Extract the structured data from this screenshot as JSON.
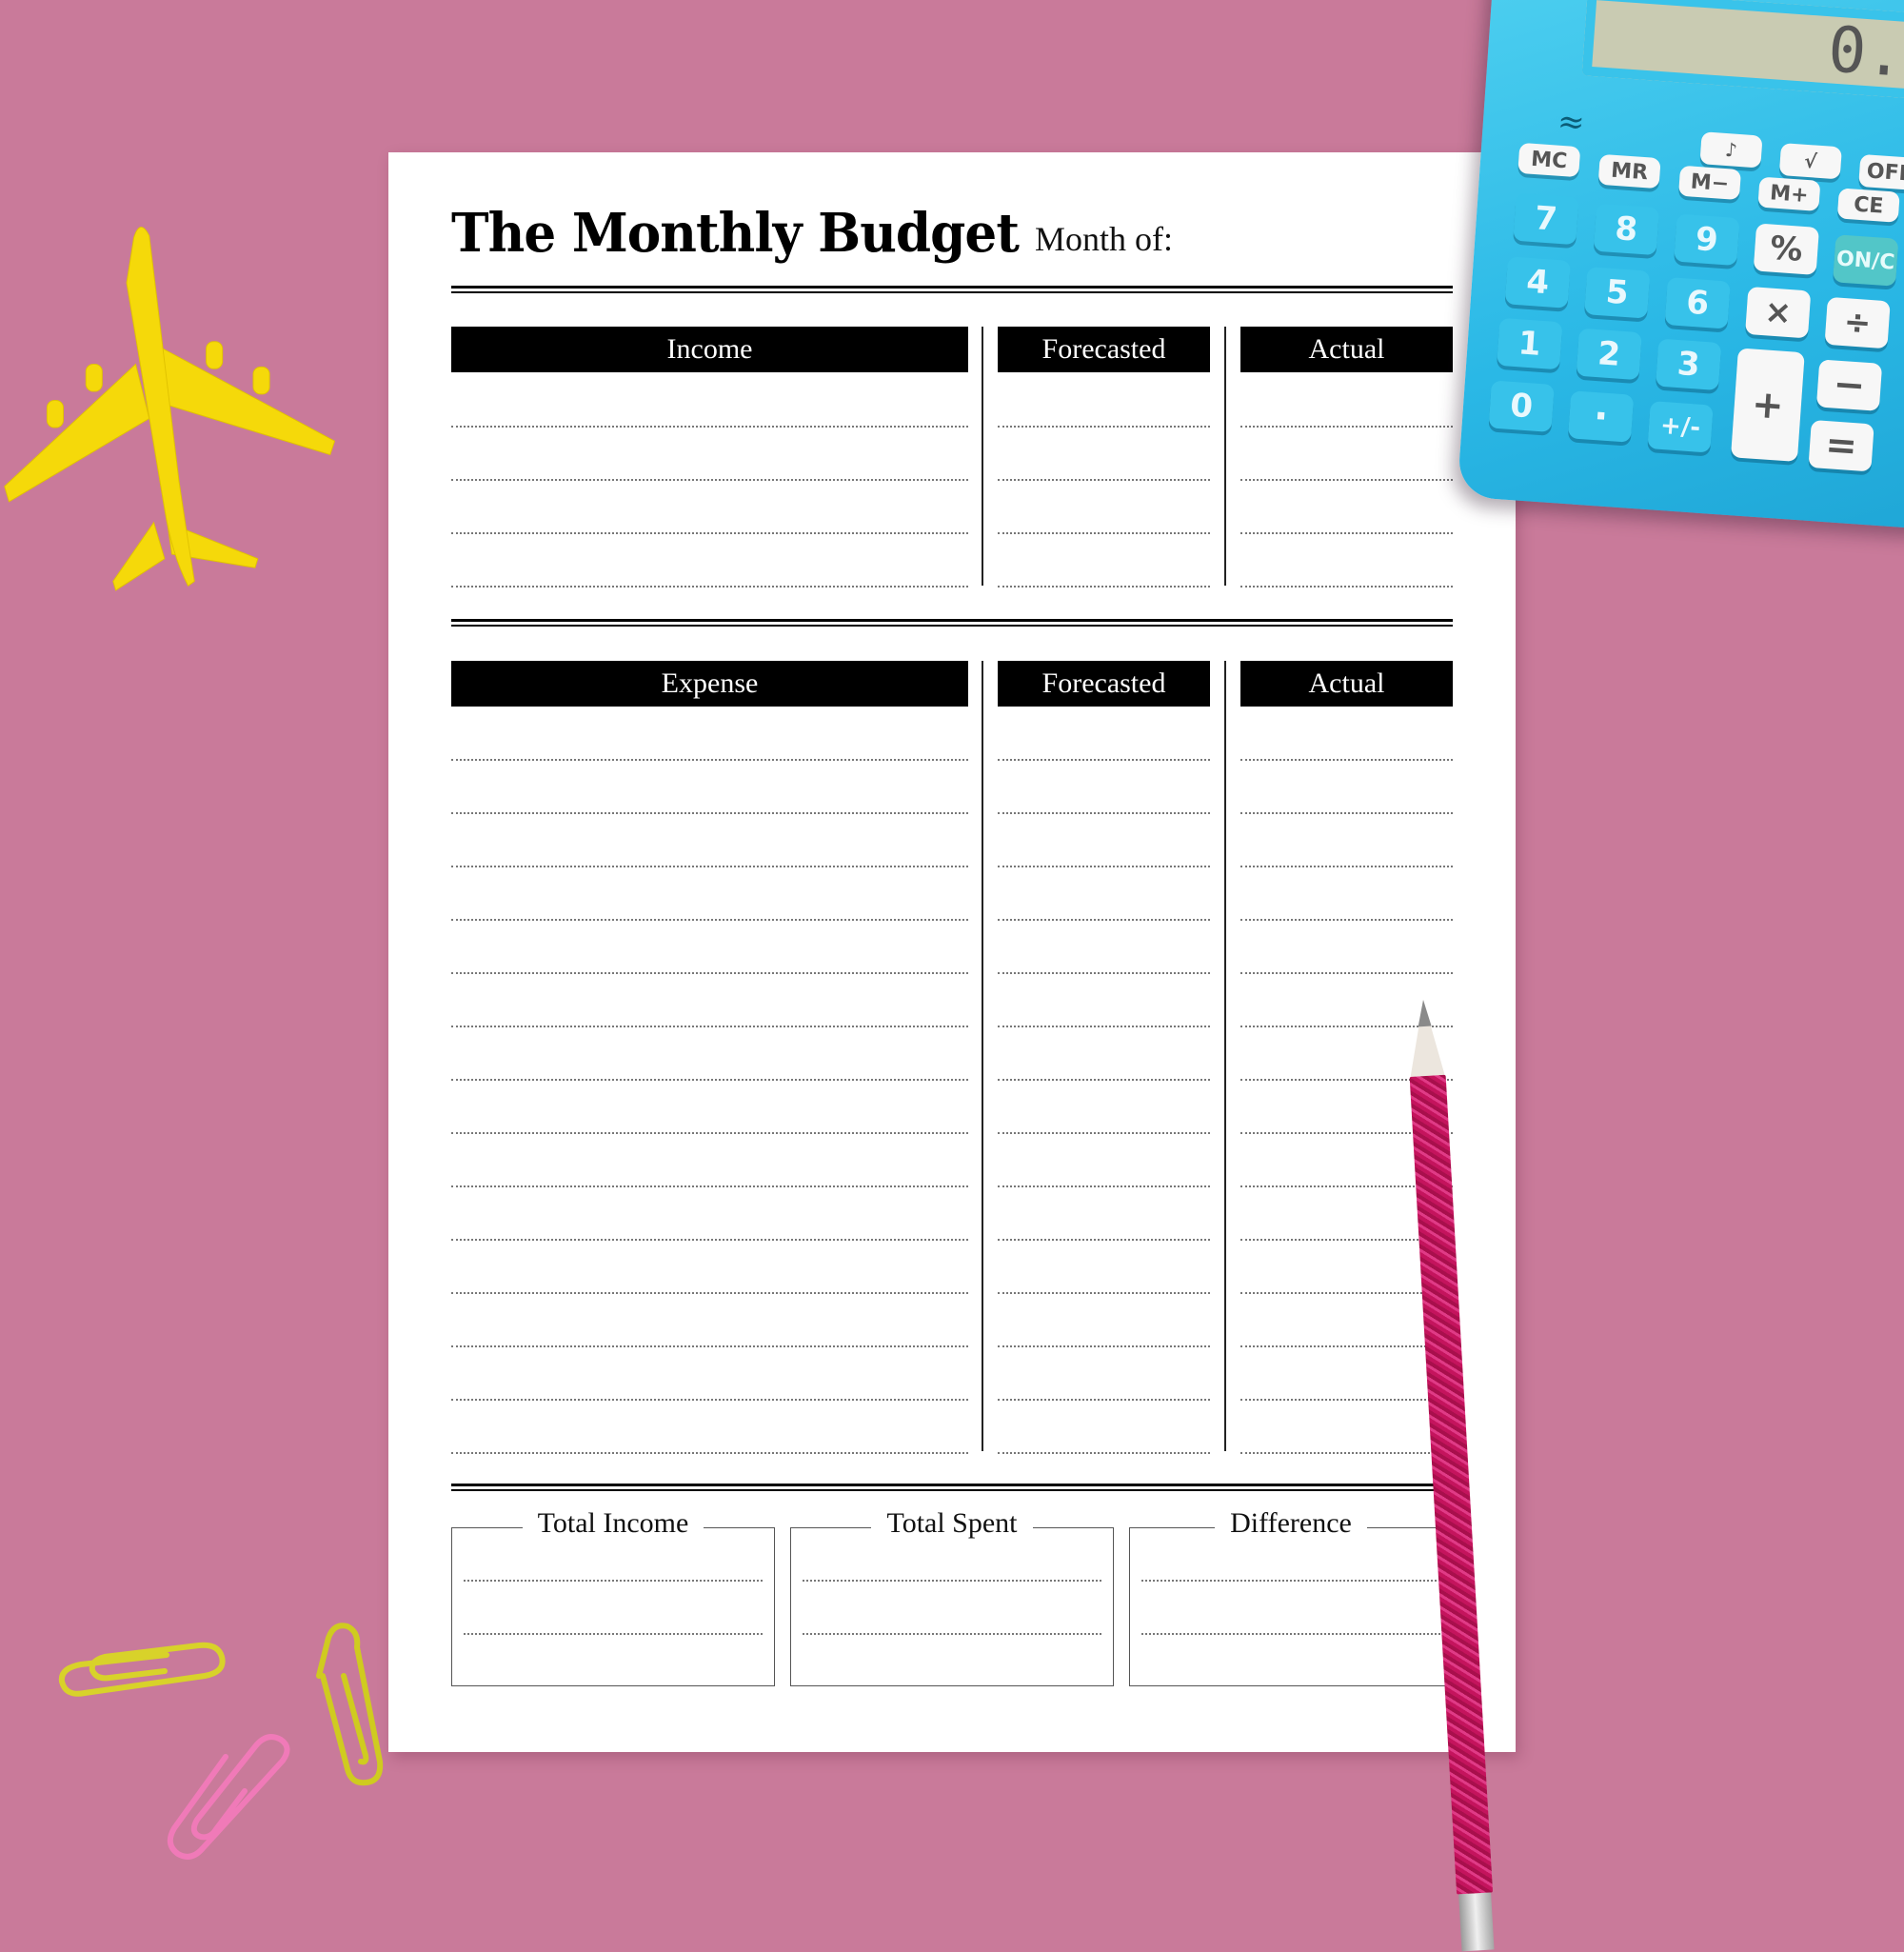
{
  "planner": {
    "title": "The Monthly Budget",
    "month_label": "Month of:",
    "income_section": {
      "headers": [
        "Income",
        "Forecasted",
        "Actual"
      ],
      "row_count": 4
    },
    "expense_section": {
      "headers": [
        "Expense",
        "Forecasted",
        "Actual"
      ],
      "row_count": 14
    },
    "totals": [
      {
        "label": "Total Income"
      },
      {
        "label": "Total Spent"
      },
      {
        "label": "Difference"
      }
    ]
  },
  "calculator": {
    "display": "0.",
    "keys": {
      "music": "♪",
      "sqrt": "√",
      "off": "OFF",
      "mc": "MC",
      "mr": "MR",
      "m_minus": "M−",
      "m_plus": "M+",
      "ce": "CE",
      "seven": "7",
      "eight": "8",
      "nine": "9",
      "percent": "%",
      "onc": "ON/C",
      "four": "4",
      "five": "5",
      "six": "6",
      "times": "×",
      "divide": "÷",
      "one": "1",
      "two": "2",
      "three": "3",
      "plus": "+",
      "minus": "−",
      "zero": "0",
      "dot": "·",
      "plusminus": "+/-",
      "equals": "="
    }
  },
  "colors": {
    "background": "#c97a9a",
    "calculator": "#2ab8e6",
    "airplane": "#f5d90a",
    "pencil": "#c4145d",
    "clip_yellow": "#d8d22a",
    "clip_pink": "#f07ab8"
  }
}
